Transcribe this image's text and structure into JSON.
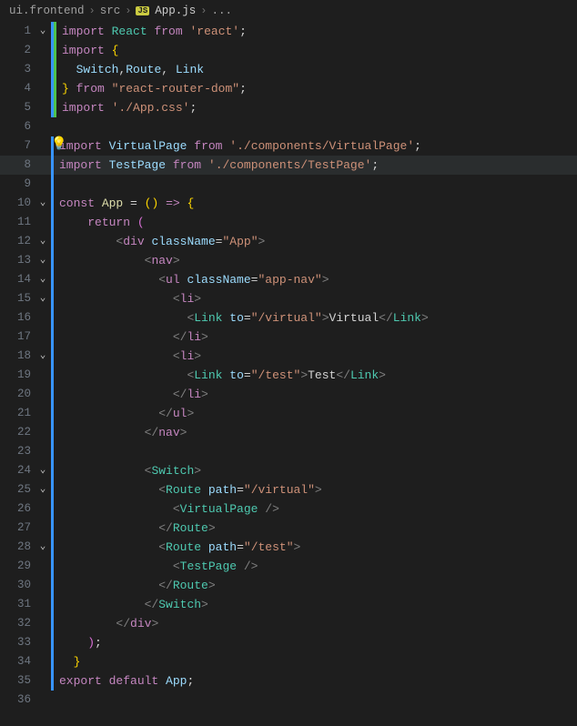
{
  "breadcrumb": {
    "seg1": "ui.frontend",
    "seg2": "src",
    "badge": "JS",
    "file": "App.js",
    "tail": "..."
  },
  "lines": [
    {
      "n": "1",
      "fold": "⌄",
      "bars": [
        "blue",
        "green"
      ],
      "html": "<span class='kw'>import</span> <span class='type'>React</span> <span class='kw'>from</span> <span class='str'>'react'</span><span class='pun'>;</span>"
    },
    {
      "n": "2",
      "fold": "",
      "bars": [
        "blue",
        "green"
      ],
      "html": "<span class='kw'>import</span> <span class='br1'>{</span>"
    },
    {
      "n": "3",
      "fold": "",
      "bars": [
        "blue",
        "green"
      ],
      "html": "  <span class='var'>Switch</span><span class='pun'>,</span><span class='var'>Route</span><span class='pun'>,</span> <span class='var'>Link</span>"
    },
    {
      "n": "4",
      "fold": "",
      "bars": [
        "blue",
        "green"
      ],
      "html": "<span class='br1'>}</span> <span class='kw'>from</span> <span class='str'>\"react-router-dom\"</span><span class='pun'>;</span>"
    },
    {
      "n": "5",
      "fold": "",
      "bars": [
        "blue",
        "green"
      ],
      "html": "<span class='kw'>import</span> <span class='str'>'./App.css'</span><span class='pun'>;</span>"
    },
    {
      "n": "6",
      "fold": "",
      "bars": [],
      "html": ""
    },
    {
      "n": "7",
      "fold": "",
      "bars": [
        "blue"
      ],
      "bulb": true,
      "html": "<span class='kw'>import</span> <span class='var'>VirtualPage</span> <span class='kw'>from</span> <span class='str'>'./components/VirtualPage'</span><span class='pun'>;</span>"
    },
    {
      "n": "8",
      "fold": "",
      "bars": [
        "blue"
      ],
      "current": true,
      "html": "<span class='kw'>import</span> <span class='var'>TestPage</span> <span class='kw'>from</span> <span class='str'>'./components/TestPage'</span><span class='pun'>;</span>"
    },
    {
      "n": "9",
      "fold": "",
      "bars": [
        "blue"
      ],
      "html": ""
    },
    {
      "n": "10",
      "fold": "⌄",
      "bars": [
        "blue"
      ],
      "html": "<span class='kw'>const</span> <span class='fn'>App</span> <span class='pun'>=</span> <span class='br1'>(</span><span class='br1'>)</span> <span class='kw'>=&gt;</span> <span class='br1'>{</span>"
    },
    {
      "n": "11",
      "fold": "",
      "bars": [
        "blue"
      ],
      "html": "    <span class='kw'>return</span> <span class='br2'>(</span>"
    },
    {
      "n": "12",
      "fold": "⌄",
      "bars": [
        "blue"
      ],
      "html": "        <span class='tag'>&lt;</span><span class='kw'>div</span> <span class='attr'>className</span><span class='pun'>=</span><span class='str'>\"App\"</span><span class='tag'>&gt;</span>"
    },
    {
      "n": "13",
      "fold": "⌄",
      "bars": [
        "blue"
      ],
      "html": "            <span class='tag'>&lt;</span><span class='kw'>nav</span><span class='tag'>&gt;</span>"
    },
    {
      "n": "14",
      "fold": "⌄",
      "bars": [
        "blue"
      ],
      "html": "              <span class='tag'>&lt;</span><span class='kw'>ul</span> <span class='attr'>className</span><span class='pun'>=</span><span class='str'>\"app-nav\"</span><span class='tag'>&gt;</span>"
    },
    {
      "n": "15",
      "fold": "⌄",
      "bars": [
        "blue"
      ],
      "html": "                <span class='tag'>&lt;</span><span class='kw'>li</span><span class='tag'>&gt;</span>"
    },
    {
      "n": "16",
      "fold": "",
      "bars": [
        "blue"
      ],
      "html": "                  <span class='tag'>&lt;</span><span class='type'>Link</span> <span class='attr'>to</span><span class='pun'>=</span><span class='str'>\"/virtual\"</span><span class='tag'>&gt;</span><span class='pun'>Virtual</span><span class='tag'>&lt;/</span><span class='type'>Link</span><span class='tag'>&gt;</span>"
    },
    {
      "n": "17",
      "fold": "",
      "bars": [
        "blue"
      ],
      "html": "                <span class='tag'>&lt;/</span><span class='kw'>li</span><span class='tag'>&gt;</span>"
    },
    {
      "n": "18",
      "fold": "⌄",
      "bars": [
        "blue"
      ],
      "html": "                <span class='tag'>&lt;</span><span class='kw'>li</span><span class='tag'>&gt;</span>"
    },
    {
      "n": "19",
      "fold": "",
      "bars": [
        "blue"
      ],
      "html": "                  <span class='tag'>&lt;</span><span class='type'>Link</span> <span class='attr'>to</span><span class='pun'>=</span><span class='str'>\"/test\"</span><span class='tag'>&gt;</span><span class='pun'>Test</span><span class='tag'>&lt;/</span><span class='type'>Link</span><span class='tag'>&gt;</span>"
    },
    {
      "n": "20",
      "fold": "",
      "bars": [
        "blue"
      ],
      "html": "                <span class='tag'>&lt;/</span><span class='kw'>li</span><span class='tag'>&gt;</span>"
    },
    {
      "n": "21",
      "fold": "",
      "bars": [
        "blue"
      ],
      "html": "              <span class='tag'>&lt;/</span><span class='kw'>ul</span><span class='tag'>&gt;</span>"
    },
    {
      "n": "22",
      "fold": "",
      "bars": [
        "blue"
      ],
      "html": "            <span class='tag'>&lt;/</span><span class='kw'>nav</span><span class='tag'>&gt;</span>"
    },
    {
      "n": "23",
      "fold": "",
      "bars": [
        "blue"
      ],
      "html": ""
    },
    {
      "n": "24",
      "fold": "⌄",
      "bars": [
        "blue"
      ],
      "html": "            <span class='tag'>&lt;</span><span class='type'>Switch</span><span class='tag'>&gt;</span>"
    },
    {
      "n": "25",
      "fold": "⌄",
      "bars": [
        "blue"
      ],
      "html": "              <span class='tag'>&lt;</span><span class='type'>Route</span> <span class='attr'>path</span><span class='pun'>=</span><span class='str'>\"/virtual\"</span><span class='tag'>&gt;</span>"
    },
    {
      "n": "26",
      "fold": "",
      "bars": [
        "blue"
      ],
      "html": "                <span class='tag'>&lt;</span><span class='type'>VirtualPage</span> <span class='tag'>/&gt;</span>"
    },
    {
      "n": "27",
      "fold": "",
      "bars": [
        "blue"
      ],
      "html": "              <span class='tag'>&lt;/</span><span class='type'>Route</span><span class='tag'>&gt;</span>"
    },
    {
      "n": "28",
      "fold": "⌄",
      "bars": [
        "blue"
      ],
      "html": "              <span class='tag'>&lt;</span><span class='type'>Route</span> <span class='attr'>path</span><span class='pun'>=</span><span class='str'>\"/test\"</span><span class='tag'>&gt;</span>"
    },
    {
      "n": "29",
      "fold": "",
      "bars": [
        "blue"
      ],
      "html": "                <span class='tag'>&lt;</span><span class='type'>TestPage</span> <span class='tag'>/&gt;</span>"
    },
    {
      "n": "30",
      "fold": "",
      "bars": [
        "blue"
      ],
      "html": "              <span class='tag'>&lt;/</span><span class='type'>Route</span><span class='tag'>&gt;</span>"
    },
    {
      "n": "31",
      "fold": "",
      "bars": [
        "blue"
      ],
      "html": "            <span class='tag'>&lt;/</span><span class='type'>Switch</span><span class='tag'>&gt;</span>"
    },
    {
      "n": "32",
      "fold": "",
      "bars": [
        "blue"
      ],
      "html": "        <span class='tag'>&lt;/</span><span class='kw'>div</span><span class='tag'>&gt;</span>"
    },
    {
      "n": "33",
      "fold": "",
      "bars": [
        "blue"
      ],
      "html": "    <span class='br2'>)</span><span class='pun'>;</span>"
    },
    {
      "n": "34",
      "fold": "",
      "bars": [
        "blue"
      ],
      "html": "  <span class='br1'>}</span>"
    },
    {
      "n": "35",
      "fold": "",
      "bars": [
        "blue"
      ],
      "html": "<span class='kw'>export</span> <span class='kw'>default</span> <span class='var'>App</span><span class='pun'>;</span>"
    },
    {
      "n": "36",
      "fold": "",
      "bars": [],
      "html": ""
    }
  ]
}
